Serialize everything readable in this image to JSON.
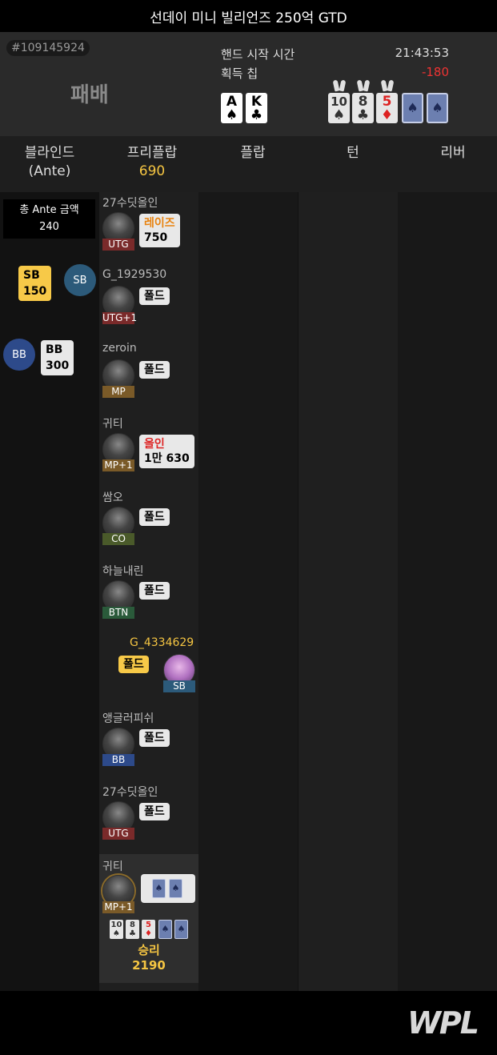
{
  "title": "선데이 미니 빌리언즈 250억 GTD",
  "hand": {
    "id": "#109145924",
    "result": "패배",
    "start_label": "핸드 시작 시간",
    "start_time": "21:43:53",
    "chips_label": "획득 칩",
    "chips_value": "-180",
    "hole_cards": [
      {
        "rank": "A",
        "suit": "♠"
      },
      {
        "rank": "K",
        "suit": "♣"
      }
    ],
    "board": [
      {
        "rank": "10",
        "suit": "♠"
      },
      {
        "rank": "8",
        "suit": "♣"
      },
      {
        "rank": "5",
        "suit": "♦"
      },
      {
        "suit": "♠"
      },
      {
        "suit": "♠"
      }
    ]
  },
  "streets": {
    "blinds": "블라인드",
    "blinds_sub": "(Ante)",
    "preflop": "프리플랍",
    "preflop_pot": "690",
    "flop": "플랍",
    "turn": "턴",
    "river": "리버"
  },
  "ante": {
    "label": "총 Ante 금액",
    "value": "240"
  },
  "blinds": {
    "sb": {
      "badge": "SB",
      "label": "SB",
      "amount": "150"
    },
    "bb": {
      "badge": "BB",
      "label": "BB",
      "amount": "300"
    }
  },
  "actions": [
    {
      "name": "27수딧올인",
      "pos": "UTG",
      "action": "레이즈",
      "amount": "750"
    },
    {
      "name": "G_1929530",
      "pos": "UTG+1",
      "action": "폴드"
    },
    {
      "name": "zeroin",
      "pos": "MP",
      "action": "폴드"
    },
    {
      "name": "귀티",
      "pos": "MP+1",
      "action": "올인",
      "amount": "1만 630"
    },
    {
      "name": "쌈오",
      "pos": "CO",
      "action": "폴드"
    },
    {
      "name": "하늘내린",
      "pos": "BTN",
      "action": "폴드"
    },
    {
      "name": "G_4334629",
      "pos": "SB",
      "action": "폴드"
    },
    {
      "name": "앵글러피쉬",
      "pos": "BB",
      "action": "폴드"
    },
    {
      "name": "27수딧올인",
      "pos": "UTG",
      "action": "폴드"
    }
  ],
  "winner": {
    "name": "귀티",
    "pos": "MP+1",
    "hand_cards": [
      "♠",
      "♠"
    ],
    "board": [
      "10♠",
      "8♣",
      "5♦",
      "♠",
      "♠"
    ],
    "label": "승리",
    "amount": "2190"
  },
  "brand": "WPL",
  "colors": {
    "accent_yellow": "#f7c948",
    "raise_orange": "#e8820e",
    "allin_red": "#dd2222",
    "loss_red": "#ee3333"
  }
}
